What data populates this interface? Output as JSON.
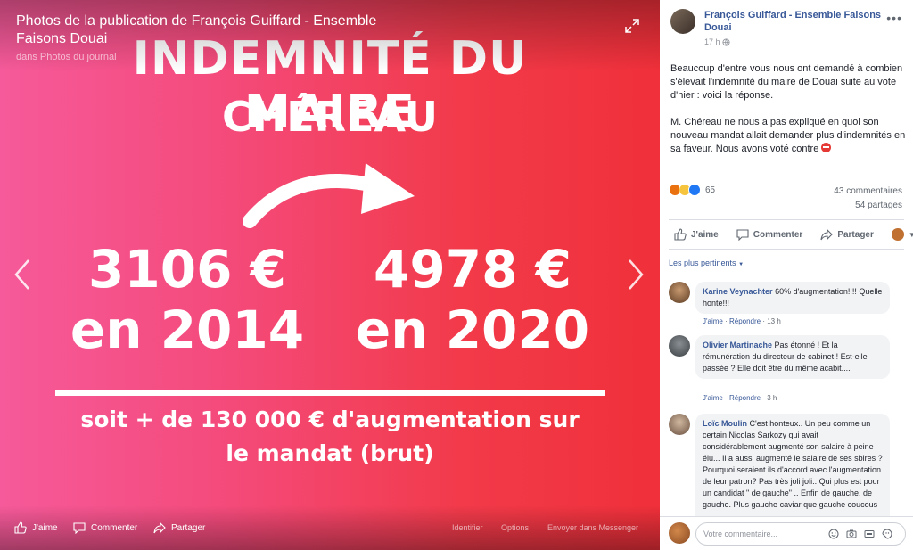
{
  "viewer": {
    "title": "Photos de la publication de François Guiffard - Ensemble Faisons Douai",
    "subtitle": "dans Photos du journal",
    "poster": {
      "title": "INDEMNITÉ DU MAIRE",
      "name": "CHÉREAU",
      "left_amount": "3106 €",
      "left_year": "en 2014",
      "right_amount": "4978 €",
      "right_year": "en 2020",
      "summary_line1": "soit  + de 130 000 € d'augmentation sur",
      "summary_line2": "le mandat (brut)"
    },
    "actions": {
      "like": "J'aime",
      "comment": "Commenter",
      "share": "Partager"
    },
    "options": {
      "identify": "Identifier",
      "options": "Options",
      "messenger": "Envoyer dans Messenger"
    }
  },
  "post": {
    "author": "François Guiffard - Ensemble Faisons Douai",
    "time": "17 h",
    "paragraph1": "Beaucoup d'entre vous nous ont demandé à combien s'élevait l'indemnité du maire de Douai suite au vote d'hier : voici la réponse.",
    "paragraph2": "M. Chéreau ne nous a pas expliqué en quoi son nouveau mandat allait demander plus d'indemnités en sa faveur. Nous avons voté contre",
    "reaction_count": "65",
    "comments_count": "43 commentaires",
    "shares_count": "54 partages",
    "actions": {
      "like": "J'aime",
      "comment": "Commenter",
      "share": "Partager"
    },
    "sort_label": "Les plus pertinents"
  },
  "comments": [
    {
      "author": "Karine Veynachter",
      "text": "60% d'augmentation!!!! Quelle honte!!!",
      "like": "J'aime",
      "reply": "Répondre",
      "time": "13 h"
    },
    {
      "author": "Olivier Martinache",
      "text": "Pas étonné ! Et la rémunération du directeur de cabinet ! Est-elle passée ? Elle doit être du même acabit....",
      "like": "J'aime",
      "reply": "Répondre",
      "time": "3 h"
    },
    {
      "author": "Loïc Moulin",
      "text": "C'est honteux.. Un peu comme un certain Nicolas Sarkozy qui avait considérablement augmenté son salaire à peine élu... Il a aussi augmenté le salaire de ses sbires ? Pourquoi seraient ils d'accord avec l'augmentation de leur patron? Pas très joli joli.. Qui plus est pour un candidat \" de gauche\" .. Enfin de gauche, de gauche. Plus gauche caviar que gauche coucous"
    }
  ],
  "compose": {
    "placeholder": "Votre commentaire..."
  }
}
